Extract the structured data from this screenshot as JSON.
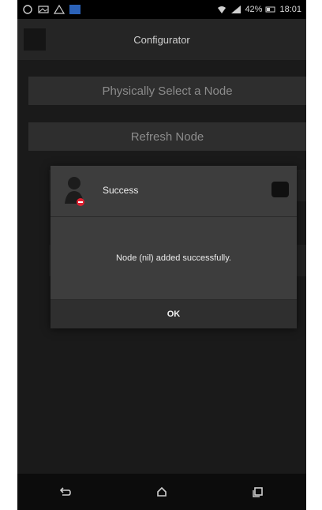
{
  "status_bar": {
    "battery": "42%",
    "time": "18:01"
  },
  "action_bar": {
    "title": "Configurator"
  },
  "buttons": {
    "select_node": "Physically Select a Node",
    "refresh_node": "Refresh Node"
  },
  "dialog": {
    "title": "Success",
    "message": "Node (nil) added successfully.",
    "ok_label": "OK"
  },
  "nav": {
    "back_icon": "back-icon",
    "home_icon": "home-icon",
    "recents_icon": "recents-icon"
  }
}
